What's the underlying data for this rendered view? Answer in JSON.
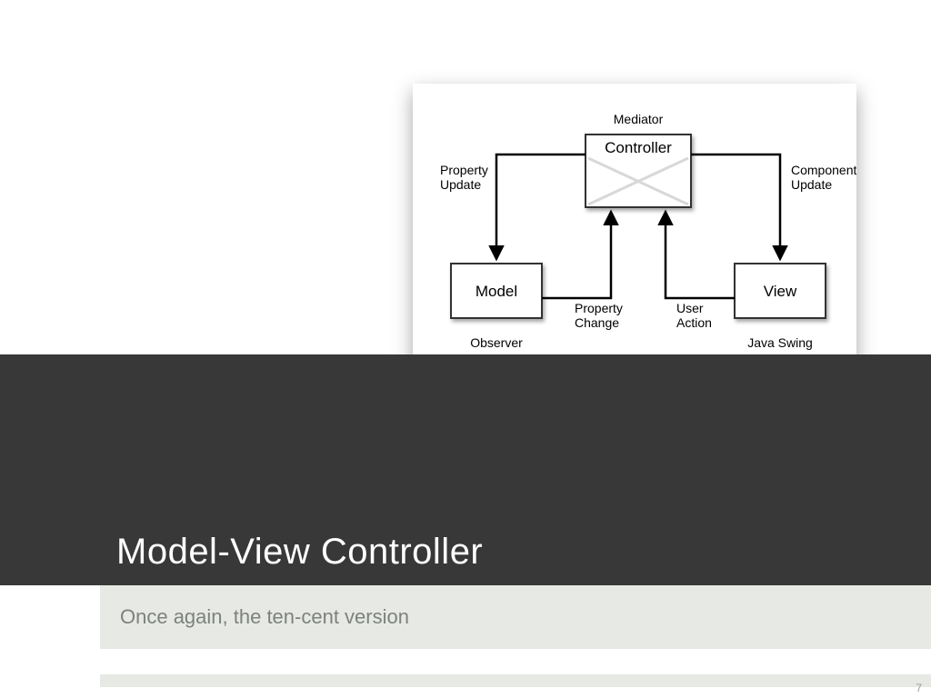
{
  "slide": {
    "title": "Model-View Controller",
    "subtitle": "Once again, the ten-cent version",
    "page_number": "7"
  },
  "diagram": {
    "nodes": {
      "controller": {
        "label": "Controller",
        "role": "Mediator"
      },
      "model": {
        "label": "Model",
        "role": "Observer"
      },
      "view": {
        "label": "View",
        "role": "Java Swing"
      }
    },
    "edges": {
      "property_update": "Property\nUpdate",
      "component_update": "Component\nUpdate",
      "property_change": "Property\nChange",
      "user_action": "User\nAction"
    }
  }
}
